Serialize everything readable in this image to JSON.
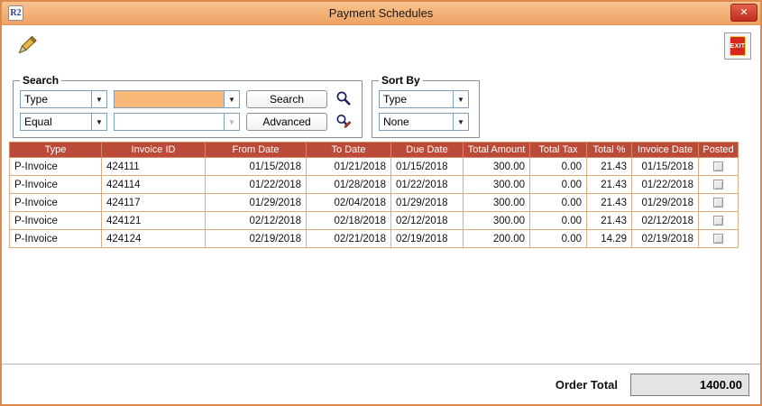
{
  "window": {
    "title": "Payment Schedules",
    "app_badge": "R2",
    "close_glyph": "✕"
  },
  "icons": {
    "combo_arrow": "▼"
  },
  "toolbar": {
    "exit_label": "EXIT"
  },
  "search": {
    "legend": "Search",
    "field_type": "Type",
    "field_value": "",
    "operator": "Equal",
    "operator_value": "",
    "search_button": "Search",
    "advanced_button": "Advanced"
  },
  "sortby": {
    "legend": "Sort By",
    "primary": "Type",
    "secondary": "None"
  },
  "table": {
    "headers": [
      "Type",
      "Invoice ID",
      "From Date",
      "To Date",
      "Due Date",
      "Total Amount",
      "Total Tax",
      "Total %",
      "Invoice Date",
      "Posted"
    ],
    "rows": [
      {
        "type": "P-Invoice",
        "invoice_id": "424111",
        "from_date": "01/15/2018",
        "to_date": "01/21/2018",
        "due_date": "01/15/2018",
        "total_amount": "300.00",
        "total_tax": "0.00",
        "total_pct": "21.43",
        "invoice_date": "01/15/2018",
        "posted": false
      },
      {
        "type": "P-Invoice",
        "invoice_id": "424114",
        "from_date": "01/22/2018",
        "to_date": "01/28/2018",
        "due_date": "01/22/2018",
        "total_amount": "300.00",
        "total_tax": "0.00",
        "total_pct": "21.43",
        "invoice_date": "01/22/2018",
        "posted": false
      },
      {
        "type": "P-Invoice",
        "invoice_id": "424117",
        "from_date": "01/29/2018",
        "to_date": "02/04/2018",
        "due_date": "01/29/2018",
        "total_amount": "300.00",
        "total_tax": "0.00",
        "total_pct": "21.43",
        "invoice_date": "01/29/2018",
        "posted": false
      },
      {
        "type": "P-Invoice",
        "invoice_id": "424121",
        "from_date": "02/12/2018",
        "to_date": "02/18/2018",
        "due_date": "02/12/2018",
        "total_amount": "300.00",
        "total_tax": "0.00",
        "total_pct": "21.43",
        "invoice_date": "02/12/2018",
        "posted": false
      },
      {
        "type": "P-Invoice",
        "invoice_id": "424124",
        "from_date": "02/19/2018",
        "to_date": "02/21/2018",
        "due_date": "02/19/2018",
        "total_amount": "200.00",
        "total_tax": "0.00",
        "total_pct": "14.29",
        "invoice_date": "02/19/2018",
        "posted": false
      }
    ]
  },
  "footer": {
    "label": "Order Total",
    "value": "1400.00"
  },
  "colors": {
    "titlebar": "#f2ab70",
    "window_border": "#e0894e",
    "table_header_bg": "#bc4a38",
    "grid_line": "#ddac82",
    "highlight_field": "#f8b878",
    "exit_red": "#d6281a"
  }
}
